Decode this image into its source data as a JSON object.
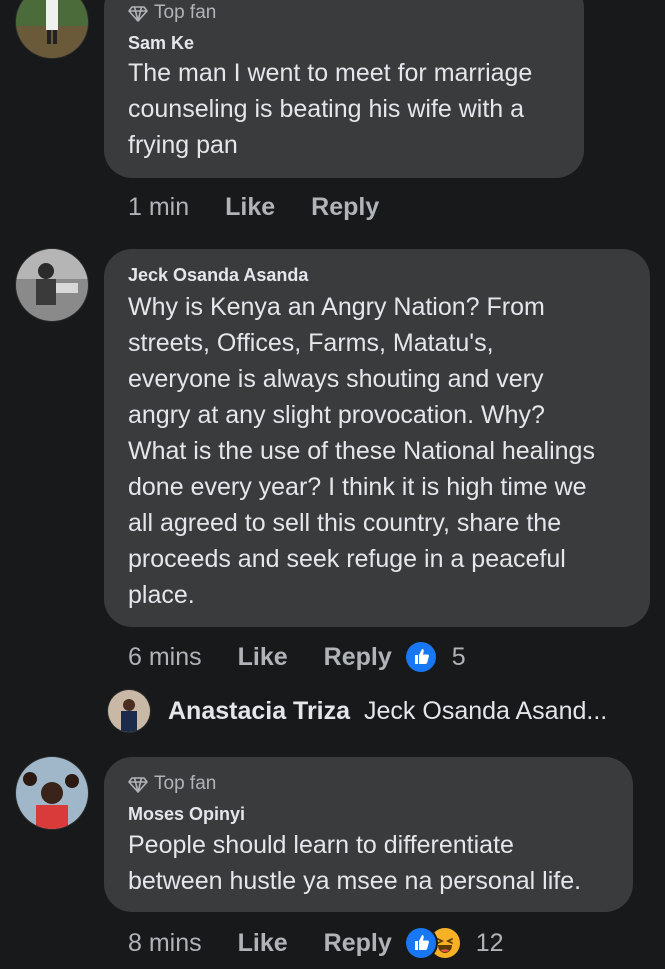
{
  "comments": [
    {
      "badge": "Top fan",
      "author": "Sam Ke",
      "text": "The man I went to meet for marriage\ncounseling is beating his wife with a\nfrying pan",
      "time": "1 min",
      "like_label": "Like",
      "reply_label": "Reply"
    },
    {
      "author": "Jeck Osanda Asanda",
      "text": "Why is Kenya an Angry Nation? From\nstreets, Offices, Farms, Matatu's,\neveryone is always shouting and very\nangry at any slight provocation. Why?\nWhat is the use of these National healings\ndone every year? I think it is high time we\nall agreed to sell this country, share the\nproceeds and seek refuge in a peaceful\nplace.",
      "time": "6 mins",
      "like_label": "Like",
      "reply_label": "Reply",
      "reaction_count": "5",
      "reactions": [
        "like-icon"
      ]
    },
    {
      "badge": "Top fan",
      "author": "Moses Opinyi",
      "text": "People should learn to differentiate\nbetween hustle ya msee na personal life.",
      "time": "8 mins",
      "like_label": "Like",
      "reply_label": "Reply",
      "reaction_count": "12",
      "reactions": [
        "like-icon",
        "haha-icon"
      ]
    }
  ],
  "reply_preview": {
    "author": "Anastacia Triza",
    "snippet": "Jeck Osanda Asand..."
  },
  "colors": {
    "background": "#18191a",
    "bubble": "#3a3b3c",
    "text": "#e4e6eb",
    "muted": "#b0b3b8",
    "like_blue": "#1877f2",
    "haha_yellow": "#f7b125"
  }
}
